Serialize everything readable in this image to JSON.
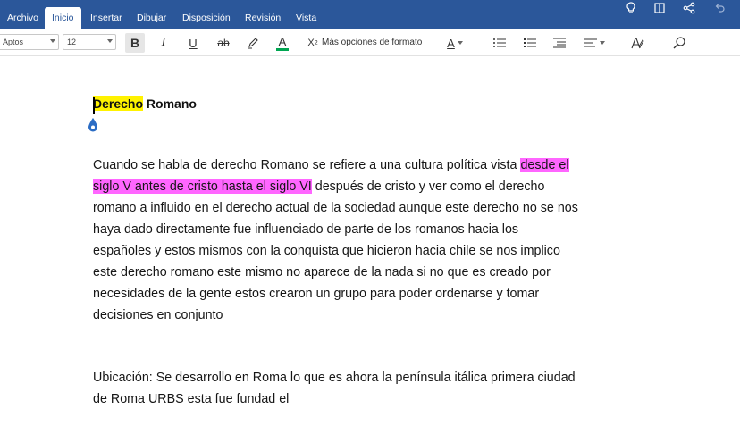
{
  "ribbon": {
    "tabs": [
      {
        "label": "Archivo",
        "active": false
      },
      {
        "label": "Inicio",
        "active": true
      },
      {
        "label": "Insertar",
        "active": false
      },
      {
        "label": "Dibujar",
        "active": false
      },
      {
        "label": "Disposición",
        "active": false
      },
      {
        "label": "Revisión",
        "active": false
      },
      {
        "label": "Vista",
        "active": false
      }
    ],
    "right_icons": [
      "lightbulb-icon",
      "reading-view-icon",
      "share-icon",
      "undo-icon"
    ],
    "color": "#2b579a"
  },
  "toolbar": {
    "font_name": "Aptos",
    "font_size": "12",
    "bold_label": "B",
    "italic_label": "I",
    "underline_label": "U",
    "strike_label": "ab",
    "font_color_label": "A",
    "subscript_label": "X",
    "subscript_index": "2",
    "more_formats_label": "Más opciones de formato",
    "style_label": "A",
    "font_color_accent": "#00a651"
  },
  "document": {
    "title_highlighted": "Derecho",
    "title_rest": " Romano",
    "paragraph1": {
      "lines": [
        {
          "before": "Cuando se habla de derecho Romano se refiere a una cultura política vista ",
          "highlight": "desde el",
          "after": ""
        },
        {
          "before": "",
          "highlight": "siglo V antes de cristo hasta el siglo VI",
          "after": " después de cristo y ver como el derecho"
        },
        {
          "before": "romano a influido en el derecho actual de la sociedad aunque este derecho no se nos",
          "highlight": "",
          "after": ""
        },
        {
          "before": "haya dado directamente fue influenciado de parte de los romanos hacia los",
          "highlight": "",
          "after": ""
        },
        {
          "before": "españoles y estos mismos con la conquista que hicieron hacia chile se nos implico",
          "highlight": "",
          "after": ""
        },
        {
          "before": "este derecho romano este mismo no aparece de la nada si no que es creado por",
          "highlight": "",
          "after": ""
        },
        {
          "before": "necesidades de la gente estos crearon un grupo para poder ordenarse y tomar",
          "highlight": "",
          "after": ""
        },
        {
          "before": "decisiones en conjunto",
          "highlight": "",
          "after": ""
        }
      ]
    },
    "paragraph2": {
      "lines": [
        "Ubicación: Se desarrollo en Roma lo que es ahora la península itálica primera ciudad",
        "de Roma URBS esta fue fundad el"
      ]
    },
    "highlight_colors": {
      "yellow": "#fff200",
      "pink": "#ff66ff"
    }
  }
}
